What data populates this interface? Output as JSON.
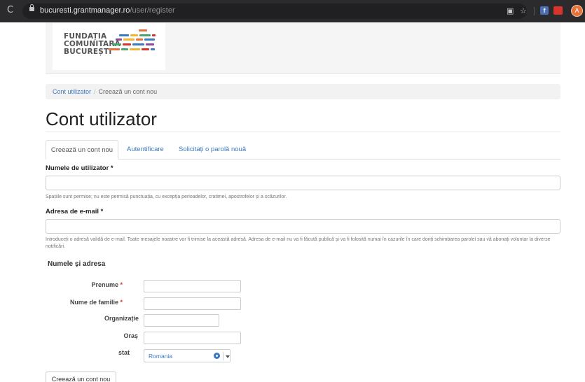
{
  "browser": {
    "reload_glyph": "C",
    "url_host": "bucuresti.grantmanager.ro",
    "url_path": "/user/register",
    "avatar_letter": "A",
    "fb_letter": "f"
  },
  "logo": {
    "line1": "FUNDAȚIA",
    "line2": "COMUNITARĂ",
    "line3": "BUCUREȘTI",
    "colors": [
      "#e8713a",
      "#3c7ac0",
      "#f2b531",
      "#4aa370",
      "#d9342b",
      "#8e4a9c"
    ]
  },
  "breadcrumb": {
    "home": "Cont utilizator",
    "separator": "/",
    "current": "Creează un cont nou"
  },
  "page_title": "Cont utilizator",
  "tabs": [
    {
      "label": "Creează un cont nou",
      "active": true
    },
    {
      "label": "Autentificare",
      "active": false
    },
    {
      "label": "Solicitați o parolă nouă",
      "active": false
    }
  ],
  "username": {
    "label": "Numele de utilizator *",
    "value": "",
    "help": "Spațiile sunt permise; nu este permisă punctuația, cu excepția perioadelor, cratimei, apostrofelor și a scăzurilor."
  },
  "email": {
    "label": "Adresa de e-mail *",
    "value": "",
    "help": "Introduceți o adresă validă de e-mail. Toate mesajele noastre vor fi trimise la această adresă. Adresa de e-mail nu va fi făcută publică și va fi folosită numai în cazurile în care doriți schimbarea parolei sau vă abonați voluntar la diverse notificări."
  },
  "address_section": {
    "title": "Numele și adresa",
    "first_name_label": "Prenume",
    "last_name_label": "Nume de familie",
    "organization_label": "Organizație",
    "city_label": "Oraș",
    "state_label": "stat",
    "required_mark": "*",
    "state_value": "Romania"
  },
  "submit_label": "Creează un cont nou"
}
